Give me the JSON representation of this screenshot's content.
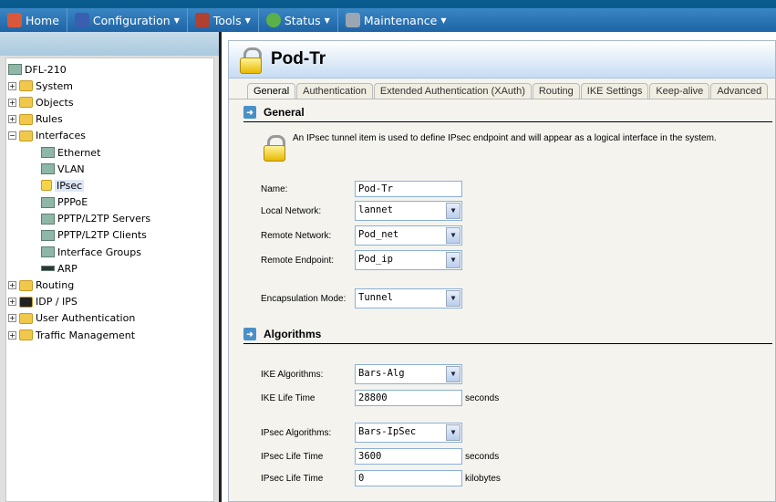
{
  "menu": [
    {
      "label": "Home",
      "icon": "home-icon",
      "caret": false
    },
    {
      "label": "Configuration",
      "icon": "configuration-icon",
      "caret": true
    },
    {
      "label": "Tools",
      "icon": "tools-icon",
      "caret": true
    },
    {
      "label": "Status",
      "icon": "status-icon",
      "caret": true
    },
    {
      "label": "Maintenance",
      "icon": "maintenance-icon",
      "caret": true
    }
  ],
  "tree": {
    "root": "DFL-210",
    "items": [
      "System",
      "Objects",
      "Rules",
      "Interfaces",
      "Ethernet",
      "VLAN",
      "IPsec",
      "PPPoE",
      "PPTP/L2TP Servers",
      "PPTP/L2TP Clients",
      "Interface Groups",
      "ARP",
      "Routing",
      "IDP / IPS",
      "User Authentication",
      "Traffic Management"
    ]
  },
  "page": {
    "title": "Pod-Tr",
    "tabs": [
      "General",
      "Authentication",
      "Extended Authentication (XAuth)",
      "Routing",
      "IKE Settings",
      "Keep-alive",
      "Advanced"
    ],
    "general_heading": "General",
    "description": "An IPsec tunnel item is used to define IPsec endpoint and will appear as a logical interface in the system.",
    "fields": {
      "name_label": "Name:",
      "name": "Pod-Tr",
      "local_label": "Local Network:",
      "local": "lannet",
      "remote_label": "Remote Network:",
      "remote": "Pod_net",
      "endpoint_label": "Remote Endpoint:",
      "endpoint": "Pod_ip",
      "encap_label": "Encapsulation Mode:",
      "encap": "Tunnel"
    },
    "algorithms_heading": "Algorithms",
    "alg": {
      "ike_label": "IKE Algorithms:",
      "ike": "Bars-Alg",
      "ike_life_label": "IKE Life Time",
      "ike_life": "28800",
      "seconds": "seconds",
      "ipsec_label": "IPsec Algorithms:",
      "ipsec": "Bars-IpSec",
      "ipsec_life_label": "IPsec Life Time",
      "ipsec_life": "3600",
      "ipsec_kb_label": "IPsec Life Time",
      "ipsec_kb": "0",
      "kilobytes": "kilobytes"
    }
  }
}
